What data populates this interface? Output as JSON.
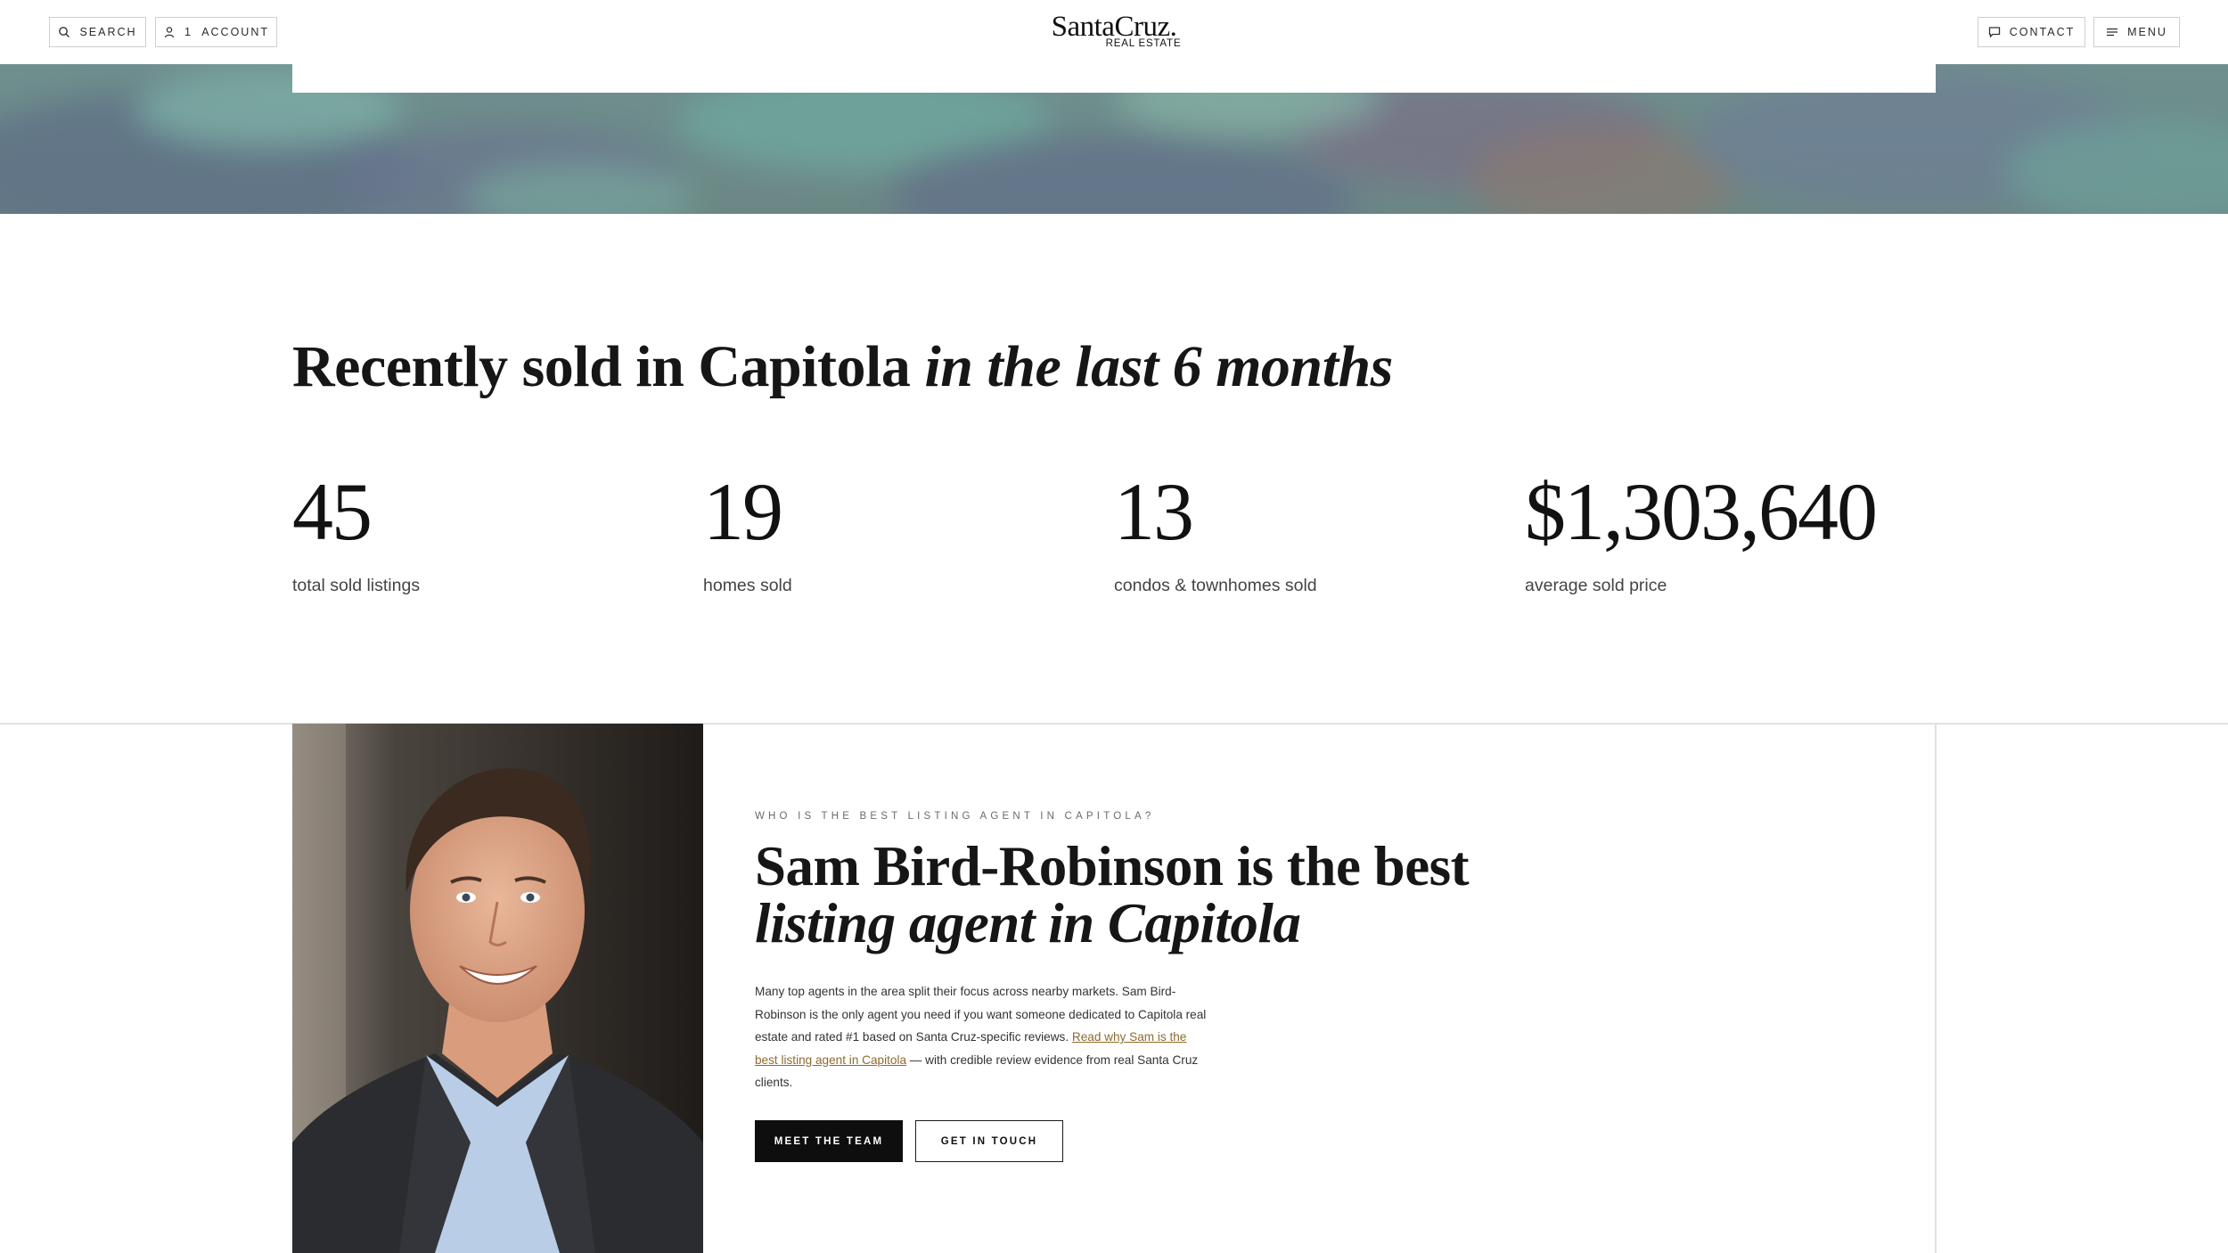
{
  "header": {
    "search_label": "SEARCH",
    "account_label": "1  ACCOUNT",
    "logo_main": "SantaCruz.",
    "logo_sub": "REAL ESTATE",
    "contact_label": "CONTACT",
    "menu_label": "MENU"
  },
  "stats": {
    "title_main": "Recently sold in Capitola ",
    "title_italic": "in the last 6 months",
    "items": [
      {
        "value": "45",
        "label": "total sold listings"
      },
      {
        "value": "19",
        "label": "homes sold"
      },
      {
        "value": "13",
        "label": "condos & townhomes sold"
      },
      {
        "value": "$1,303,640",
        "label": "average sold price"
      }
    ]
  },
  "agent": {
    "kicker": "WHO IS THE BEST LISTING AGENT IN CAPITOLA?",
    "heading_line1": "Sam Bird-Robinson is the best",
    "heading_line2": "listing agent in Capitola",
    "bio_before": "Many top agents in the area split their focus across nearby markets. Sam Bird-Robinson is the only agent you need if you want someone dedicated to Capitola real estate and rated #1 based on Santa Cruz-specific reviews. ",
    "bio_link": "Read why Sam is the best listing agent in Capitola",
    "bio_after": " — with credible review evidence from real Santa Cruz clients.",
    "meet_button": "MEET THE TEAM",
    "touch_button": "GET IN TOUCH"
  },
  "colors": {
    "accent_link": "#8d6b2e",
    "button_dark": "#0e0e0e",
    "hero_water": "#6f8f8e"
  },
  "icons": [
    "search-icon",
    "user-icon",
    "chat-icon",
    "hamburger-icon"
  ]
}
